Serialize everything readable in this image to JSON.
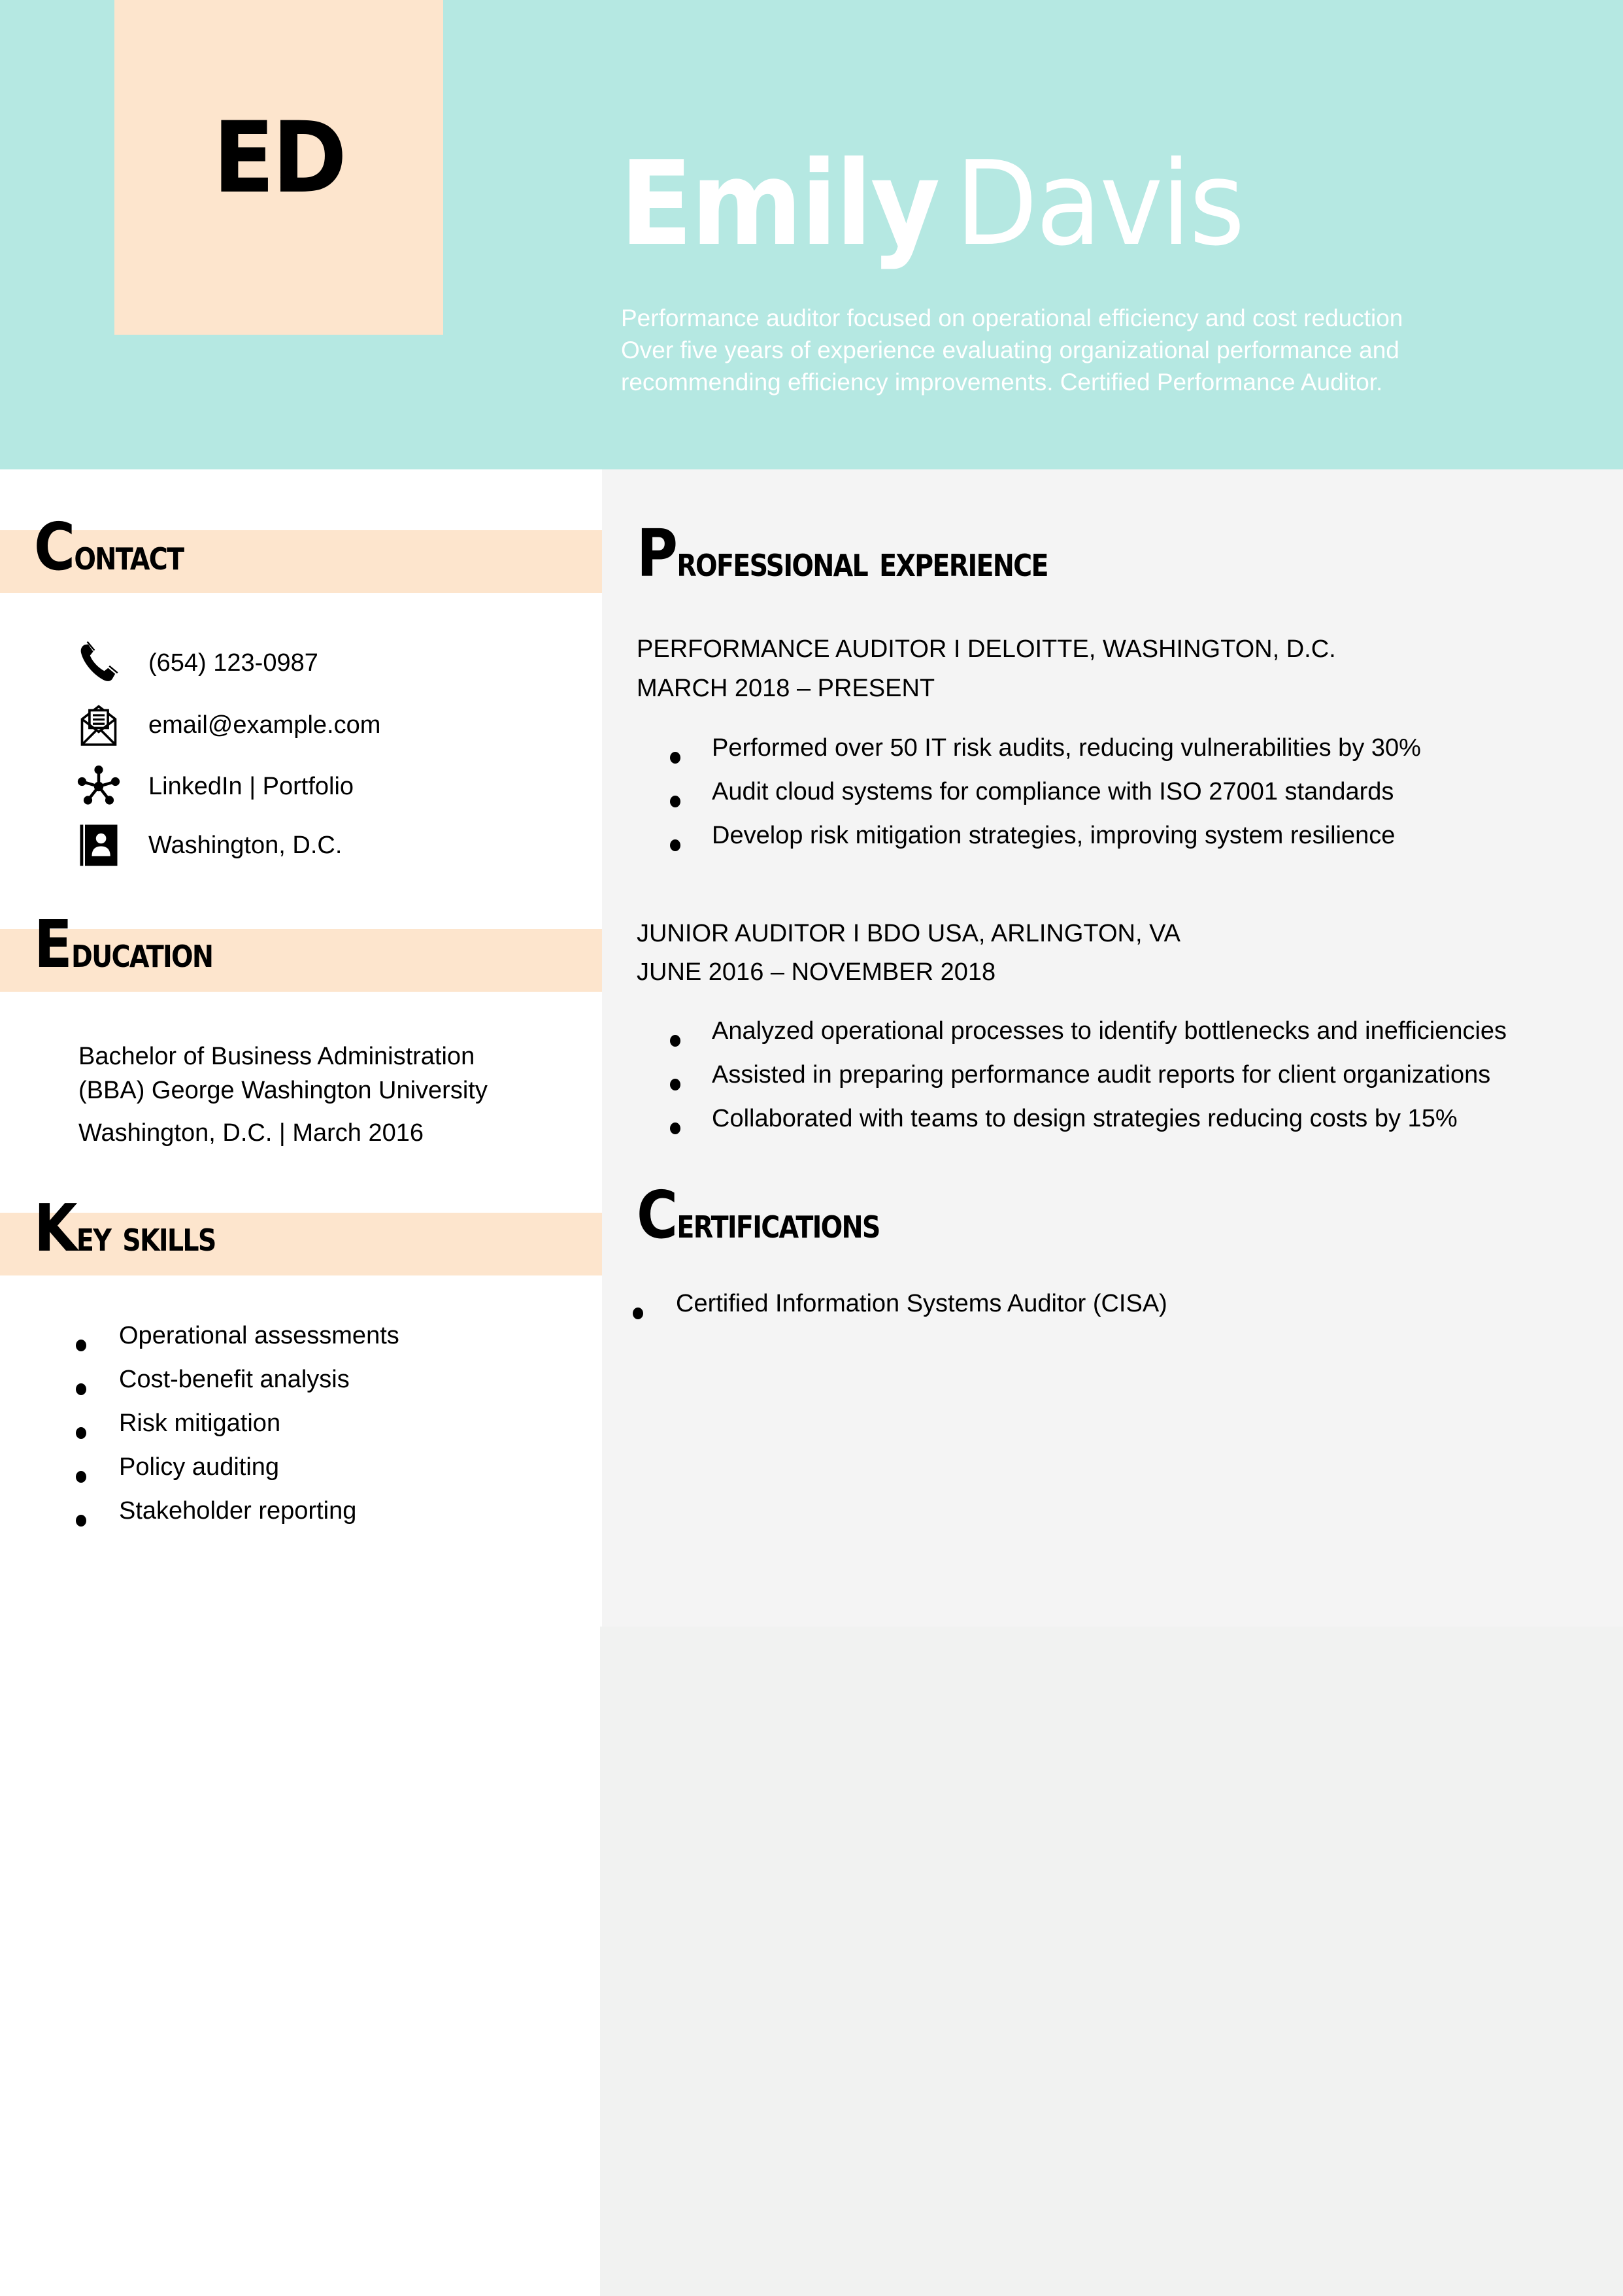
{
  "header": {
    "monogram": "ED",
    "first_name": "Emily",
    "last_name": "Davis",
    "summary_lines": [
      "Performance auditor focused on operational efficiency and cost reduction",
      "Over five years of experience evaluating organizational performance and",
      "recommending efficiency improvements. Certified Performance Auditor."
    ],
    "colors": {
      "banner": "#b5e8e2",
      "monogram_box": "#fde5cd"
    }
  },
  "contact": {
    "title_initial": "C",
    "title_rest": "ontact",
    "items": [
      {
        "icon": "phone-icon",
        "text": "(654) 123-0987"
      },
      {
        "icon": "envelope-icon",
        "text": "email@example.com"
      },
      {
        "icon": "network-icon",
        "text": "LinkedIn | Portfolio"
      },
      {
        "icon": "contact-card-icon",
        "text": "Washington, D.C."
      }
    ]
  },
  "education": {
    "title_initial": "E",
    "title_rest": "ducation",
    "degree_line1": "Bachelor of Business Administration",
    "degree_line2": "(BBA) George Washington University",
    "location_date": "Washington, D.C. | March 2016"
  },
  "skills": {
    "title_initial": "K",
    "title_rest": "ey skills",
    "items": [
      "Operational assessments",
      "Cost-benefit analysis",
      "Risk mitigation",
      "Policy auditing",
      "Stakeholder reporting"
    ]
  },
  "experience": {
    "title_initial": "P",
    "title_rest": "rofessional experience",
    "jobs": [
      {
        "title": "PERFORMANCE AUDITOR I DELOITTE, WASHINGTON, D.C.",
        "dates": "MARCH 2018 – PRESENT",
        "bullets": [
          "Performed over 50 IT risk audits, reducing vulnerabilities by 30%",
          "Audit cloud systems for compliance with ISO 27001 standards",
          "Develop risk mitigation strategies, improving system resilience"
        ]
      },
      {
        "title": "JUNIOR AUDITOR I BDO USA, ARLINGTON, VA",
        "dates": "JUNE 2016 – NOVEMBER 2018",
        "bullets": [
          "Analyzed operational processes to identify bottlenecks and inefficiencies",
          "Assisted in preparing performance audit reports for client organizations",
          "Collaborated with teams to design strategies reducing costs by 15%"
        ]
      }
    ]
  },
  "certifications": {
    "title_initial": "C",
    "title_rest": "ertifications",
    "items": [
      "Certified Information Systems Auditor (CISA)"
    ]
  }
}
